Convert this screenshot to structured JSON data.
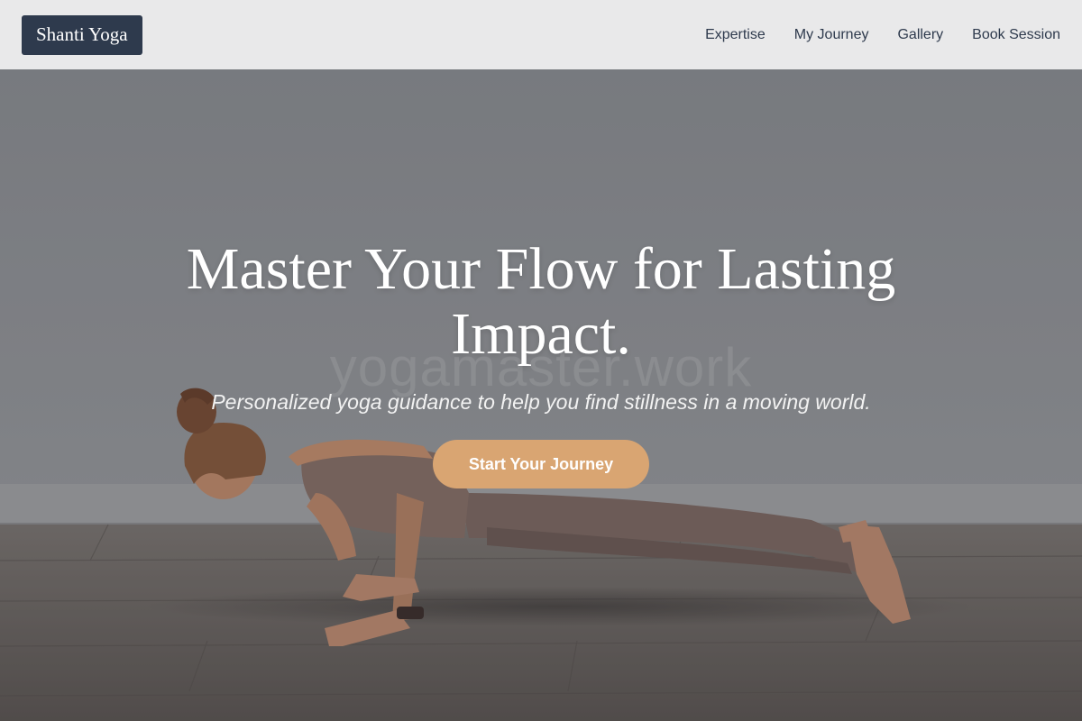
{
  "header": {
    "brand": "Shanti Yoga",
    "nav": [
      "Expertise",
      "My Journey",
      "Gallery",
      "Book Session"
    ]
  },
  "hero": {
    "title": "Master Your Flow for Lasting Impact.",
    "subtitle": "Personalized yoga guidance to help you find stillness in a moving world.",
    "cta_label": "Start Your Journey",
    "watermark": "yogamaster.work",
    "image": "woman-in-chaturanga-plank-pose-photo"
  },
  "colors": {
    "header_bg": "#e9e9ea",
    "brand_bg": "#2e3a4d",
    "nav_text": "#2e3a4d",
    "cta_bg": "#d9a572",
    "wall": "#8a8c90",
    "floor": "#6b6460"
  }
}
